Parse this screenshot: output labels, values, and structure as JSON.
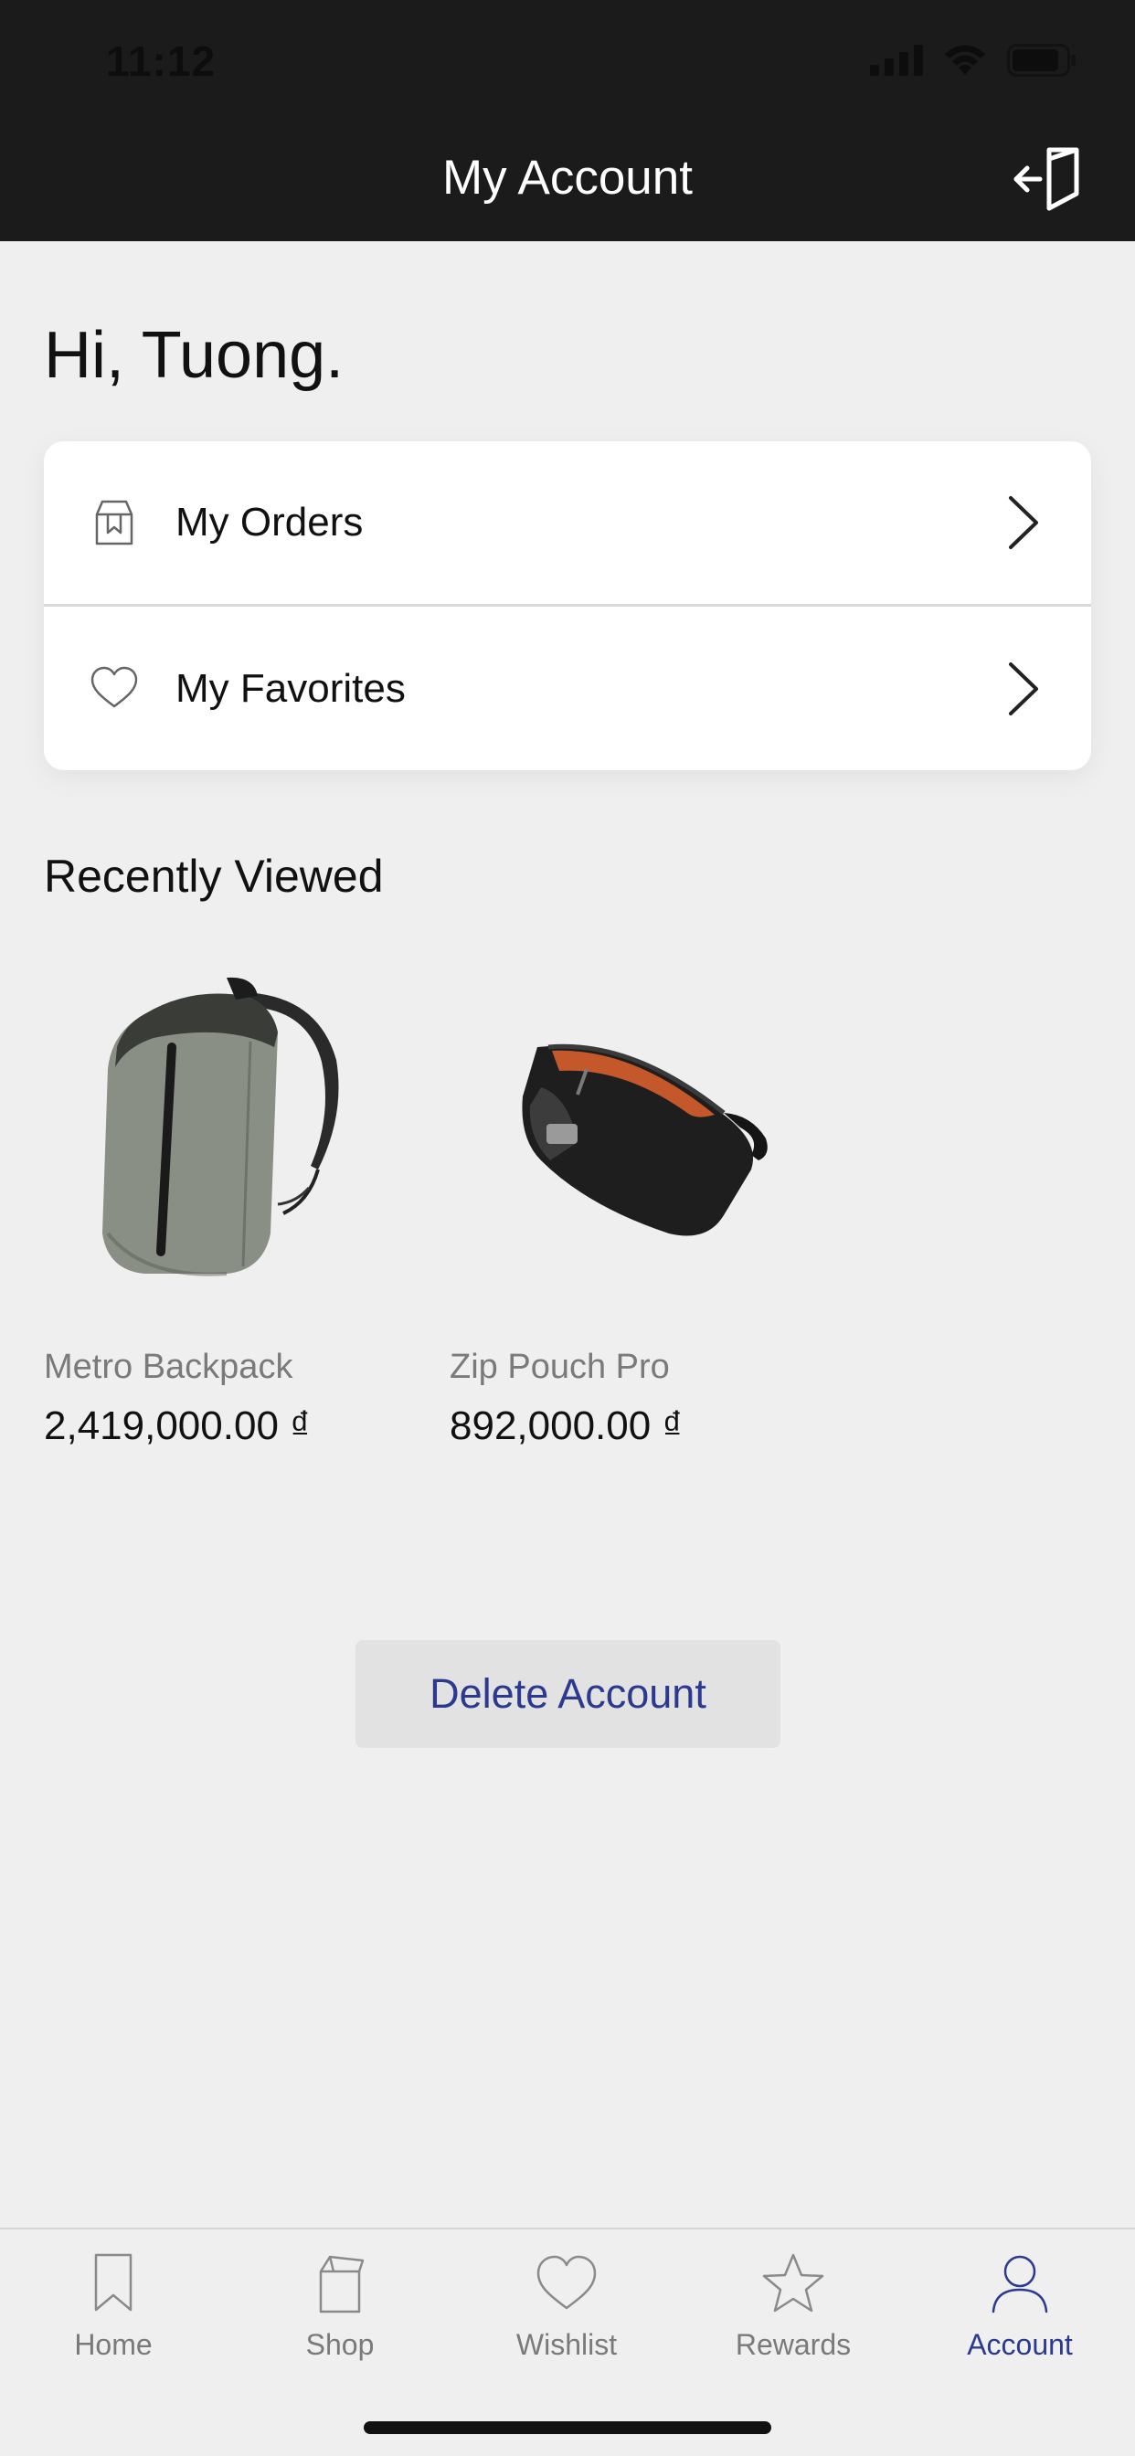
{
  "status": {
    "time": "11:12"
  },
  "header": {
    "title": "My Account"
  },
  "greeting": "Hi,  Tuong.",
  "menu": [
    {
      "label": "My Orders",
      "icon": "box-icon"
    },
    {
      "label": "My Favorites",
      "icon": "heart-icon"
    }
  ],
  "recently_viewed": {
    "title": "Recently Viewed",
    "products": [
      {
        "name": "Metro Backpack",
        "price": "2,419,000.00 ₫",
        "image": "backpack-image"
      },
      {
        "name": "Zip Pouch Pro",
        "price": "892,000.00 ₫",
        "image": "pouch-image"
      }
    ]
  },
  "actions": {
    "delete_account": "Delete Account"
  },
  "tabbar": {
    "tabs": [
      {
        "label": "Home",
        "icon": "bookmark-icon",
        "active": false
      },
      {
        "label": "Shop",
        "icon": "shopping-bag-icon",
        "active": false
      },
      {
        "label": "Wishlist",
        "icon": "heart-icon",
        "active": false
      },
      {
        "label": "Rewards",
        "icon": "star-icon",
        "active": false
      },
      {
        "label": "Account",
        "icon": "user-icon",
        "active": true
      }
    ]
  },
  "colors": {
    "header_bg": "#1b1b1b",
    "accent": "#2b3a8f",
    "page_bg": "#efefef"
  }
}
